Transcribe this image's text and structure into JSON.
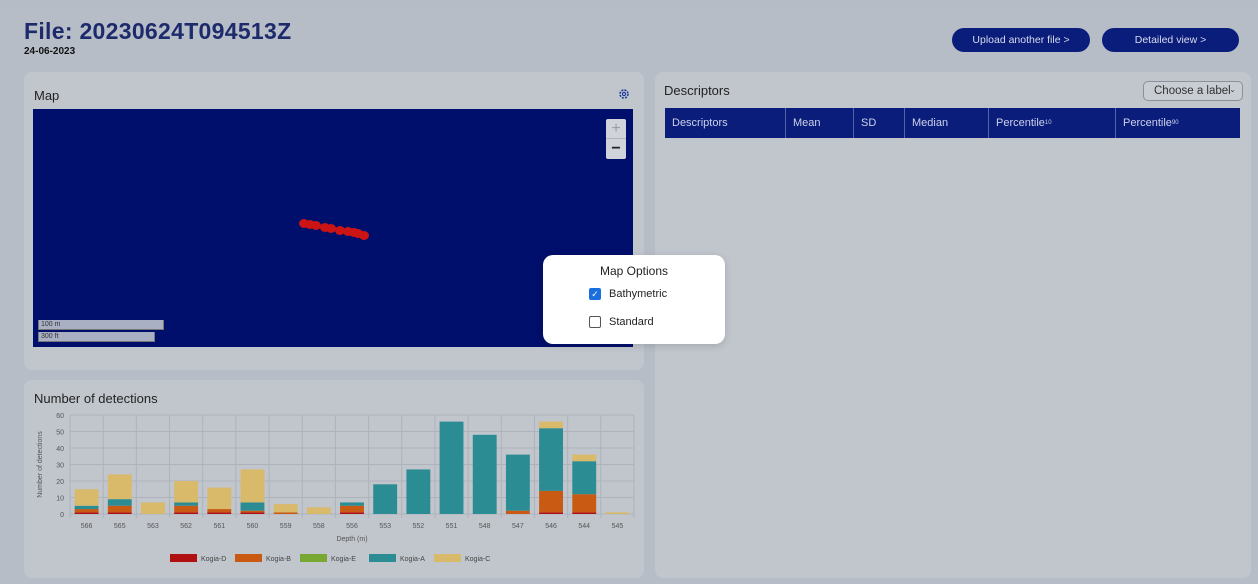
{
  "header": {
    "title": "File: 20230624T094513Z",
    "date": "24-06-2023",
    "upload_label": "Upload another file >",
    "detail_label": "Detailed view >"
  },
  "map_panel": {
    "title": "Map",
    "settings_icon": "gear-icon",
    "zoom_in": "+",
    "zoom_out": "−",
    "scale_m": "100 m",
    "scale_ft": "300 ft",
    "track_color": "#cc1414",
    "background_color": "#000f6b"
  },
  "map_options": {
    "title": "Map Options",
    "options": [
      {
        "label": "Bathymetric",
        "checked": true
      },
      {
        "label": "Standard",
        "checked": false
      }
    ]
  },
  "detections_panel": {
    "title": "Number of detections"
  },
  "chart_data": {
    "type": "bar",
    "stacked": true,
    "xlabel": "Depth (m)",
    "ylabel": "Number of detections",
    "ylim": [
      0,
      60
    ],
    "yticks": [
      0,
      10,
      20,
      30,
      40,
      50,
      60
    ],
    "grid": true,
    "legend_position": "bottom",
    "categories": [
      "566",
      "565",
      "563",
      "562",
      "561",
      "560",
      "559",
      "558",
      "556",
      "553",
      "552",
      "551",
      "548",
      "547",
      "546",
      "544",
      "545"
    ],
    "series": [
      {
        "name": "Kogia-D",
        "color": "#b01010",
        "values": [
          1,
          1,
          0,
          1,
          1,
          1,
          0,
          0,
          1,
          0,
          0,
          0,
          0,
          0,
          1,
          1,
          0
        ]
      },
      {
        "name": "Kogia-B",
        "color": "#c85a14",
        "values": [
          2,
          4,
          0,
          4,
          2,
          1,
          1,
          0,
          4,
          0,
          0,
          0,
          0,
          2,
          13,
          11,
          0
        ]
      },
      {
        "name": "Kogia-E",
        "color": "#79a832",
        "values": [
          0,
          0,
          0,
          0,
          0,
          0,
          0,
          0,
          0,
          0,
          0,
          0,
          0,
          0,
          0,
          0,
          0
        ]
      },
      {
        "name": "Kogia-A",
        "color": "#2c8c93",
        "values": [
          2,
          4,
          0,
          2,
          0,
          5,
          0,
          0,
          2,
          18,
          27,
          56,
          48,
          34,
          38,
          20,
          0
        ]
      },
      {
        "name": "Kogia-C",
        "color": "#d9b96a",
        "values": [
          10,
          15,
          7,
          13,
          13,
          20,
          5,
          4,
          0,
          0,
          0,
          0,
          0,
          0,
          4,
          4,
          1
        ]
      }
    ]
  },
  "descriptors_panel": {
    "title": "Descriptors",
    "select_placeholder": "Choose a label",
    "columns": [
      "Descriptors",
      "Mean",
      "SD",
      "Median",
      "Percentile",
      "Percentile"
    ],
    "percentile_subs": [
      "10",
      "90"
    ]
  }
}
